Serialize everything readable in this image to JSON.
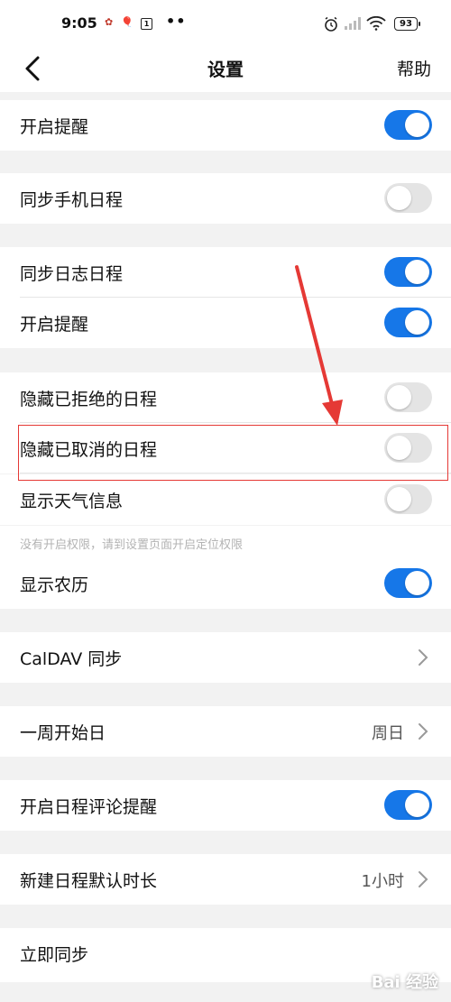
{
  "status": {
    "time": "9:05",
    "battery": "93",
    "icon_box_text": "1",
    "left_dots": "••"
  },
  "nav": {
    "title": "设置",
    "help": "帮助"
  },
  "rows": {
    "reminder1": "开启提醒",
    "sync_phone": "同步手机日程",
    "sync_log": "同步日志日程",
    "reminder2": "开启提醒",
    "hide_rejected": "隐藏已拒绝的日程",
    "hide_cancelled": "隐藏已取消的日程",
    "weather": "显示天气信息",
    "lunar": "显示农历",
    "caldav": "CalDAV 同步",
    "week_start": "一周开始日",
    "week_start_value": "周日",
    "comment_reminder": "开启日程评论提醒",
    "default_duration": "新建日程默认时长",
    "default_duration_value": "1小时",
    "sync_now": "立即同步"
  },
  "toggles": {
    "reminder1": true,
    "sync_phone": false,
    "sync_log": true,
    "reminder2": true,
    "hide_rejected": false,
    "hide_cancelled": false,
    "weather": false,
    "lunar": true,
    "comment_reminder": true
  },
  "hint": "没有开启权限，请到设置页面开启定位权限",
  "watermark": "Bai 经验",
  "colors": {
    "accent": "#1677e8",
    "annotation": "#e53935"
  }
}
